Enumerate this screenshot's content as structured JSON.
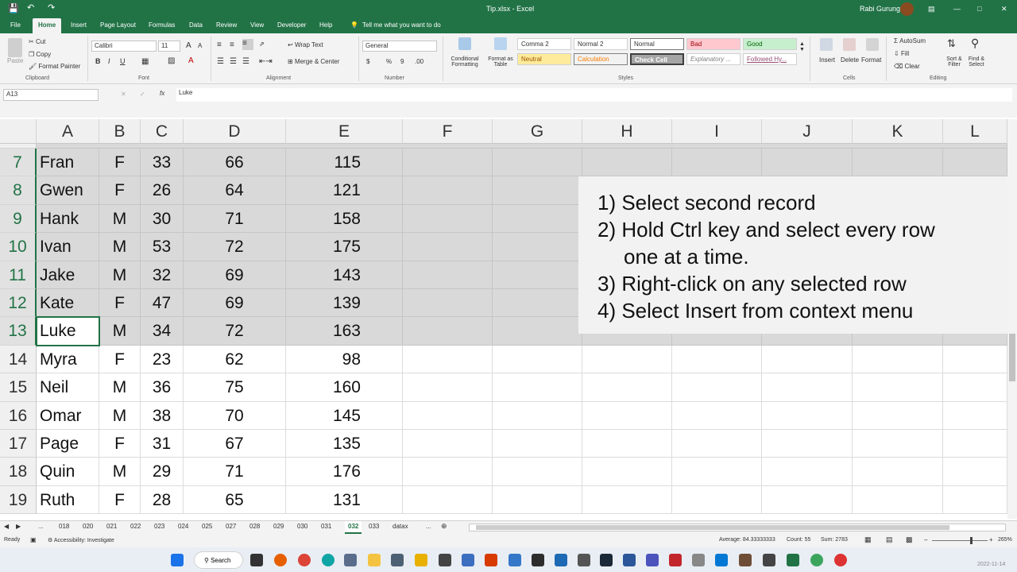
{
  "window": {
    "file_title": "Tip.xlsx",
    "app": "Excel",
    "user": "Rabi Gurung",
    "tell_me": "Tell me what you want to do"
  },
  "ribbon_tabs": [
    "File",
    "Home",
    "Insert",
    "Page Layout",
    "Formulas",
    "Data",
    "Review",
    "View",
    "Developer",
    "Help"
  ],
  "ribbon": {
    "clipboard": {
      "paste": "Paste",
      "cut": "Cut",
      "copy": "Copy",
      "format_painter": "Format Painter",
      "group": "Clipboard"
    },
    "font": {
      "name": "Calibri",
      "size": "11",
      "group": "Font"
    },
    "alignment": {
      "wrap": "Wrap Text",
      "merge": "Merge & Center",
      "group": "Alignment"
    },
    "number": {
      "format": "General",
      "group": "Number"
    },
    "styles": {
      "conditional": "Conditional Formatting",
      "format_table": "Format as Table",
      "items": [
        "Comma 2",
        "Normal 2",
        "Normal",
        "Bad",
        "Good",
        "Neutral",
        "Calculation",
        "Check Cell",
        "Explanatory ...",
        "Followed Hy..."
      ],
      "group": "Styles"
    },
    "cells": {
      "insert": "Insert",
      "delete": "Delete",
      "format": "Format",
      "group": "Cells"
    },
    "editing": {
      "autosum": "AutoSum",
      "fill": "Fill",
      "clear": "Clear",
      "sort": "Sort & Filter",
      "find": "Find & Select",
      "group": "Editing"
    }
  },
  "formula_bar": {
    "name_box": "A13",
    "value": "Luke"
  },
  "columns": [
    "A",
    "B",
    "C",
    "D",
    "E",
    "F",
    "G",
    "H",
    "I",
    "J",
    "K",
    "L"
  ],
  "rows": [
    {
      "num": "7",
      "name": "Fran",
      "sex": "F",
      "c": "33",
      "d": "66",
      "e": "115",
      "selected": true
    },
    {
      "num": "8",
      "name": "Gwen",
      "sex": "F",
      "c": "26",
      "d": "64",
      "e": "121",
      "selected": true
    },
    {
      "num": "9",
      "name": "Hank",
      "sex": "M",
      "c": "30",
      "d": "71",
      "e": "158",
      "selected": true
    },
    {
      "num": "10",
      "name": "Ivan",
      "sex": "M",
      "c": "53",
      "d": "72",
      "e": "175",
      "selected": true
    },
    {
      "num": "11",
      "name": "Jake",
      "sex": "M",
      "c": "32",
      "d": "69",
      "e": "143",
      "selected": true
    },
    {
      "num": "12",
      "name": "Kate",
      "sex": "F",
      "c": "47",
      "d": "69",
      "e": "139",
      "selected": true
    },
    {
      "num": "13",
      "name": "Luke",
      "sex": "M",
      "c": "34",
      "d": "72",
      "e": "163",
      "selected": true
    },
    {
      "num": "14",
      "name": "Myra",
      "sex": "F",
      "c": "23",
      "d": "62",
      "e": "98",
      "selected": false
    },
    {
      "num": "15",
      "name": "Neil",
      "sex": "M",
      "c": "36",
      "d": "75",
      "e": "160",
      "selected": false
    },
    {
      "num": "16",
      "name": "Omar",
      "sex": "M",
      "c": "38",
      "d": "70",
      "e": "145",
      "selected": false
    },
    {
      "num": "17",
      "name": "Page",
      "sex": "F",
      "c": "31",
      "d": "67",
      "e": "135",
      "selected": false
    },
    {
      "num": "18",
      "name": "Quin",
      "sex": "M",
      "c": "29",
      "d": "71",
      "e": "176",
      "selected": false
    },
    {
      "num": "19",
      "name": "Ruth",
      "sex": "F",
      "c": "28",
      "d": "65",
      "e": "131",
      "selected": false
    }
  ],
  "note": [
    "1) Select second record",
    "2) Hold Ctrl key and select every row",
    "one at a time.",
    "3) Right-click on any selected row",
    "4) Select Insert from context menu"
  ],
  "sheet_tabs": [
    "...",
    "018",
    "020",
    "021",
    "022",
    "023",
    "024",
    "025",
    "027",
    "028",
    "029",
    "030",
    "031",
    "032",
    "033",
    "datax",
    "..."
  ],
  "active_sheet": "032",
  "status": {
    "ready": "Ready",
    "accessibility": "Accessibility: Investigate",
    "average": "Average: 84.33333333",
    "count": "Count: 55",
    "sum": "Sum: 2783",
    "zoom": "265%"
  },
  "taskbar": {
    "search": "Search"
  },
  "colors": {
    "accent": "#217346",
    "selection": "#d9d9d9"
  }
}
